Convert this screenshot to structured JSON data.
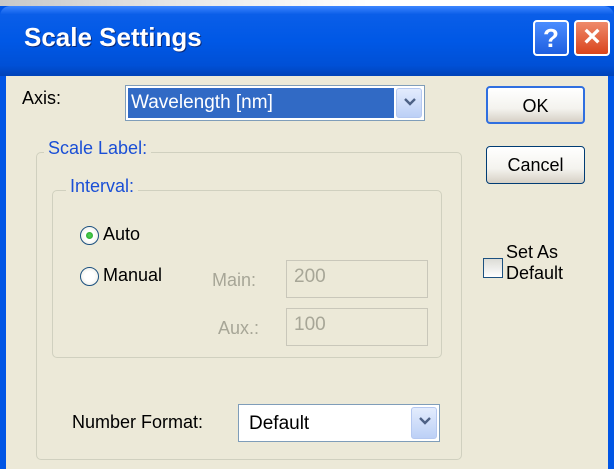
{
  "dialog": {
    "title": "Scale Settings",
    "help_label": "?",
    "close_label": "×"
  },
  "axis": {
    "label": "Axis:",
    "value": "Wavelength [nm]"
  },
  "buttons": {
    "ok_label": "OK",
    "cancel_label": "Cancel"
  },
  "scale_label": {
    "legend": "Scale Label:",
    "interval": {
      "legend": "Interval:",
      "auto_label": "Auto",
      "auto_selected": true,
      "manual_label": "Manual",
      "manual_selected": false,
      "main_label": "Main:",
      "main_value": "200",
      "aux_label": "Aux.:",
      "aux_value": "100"
    },
    "number_format": {
      "label": "Number Format:",
      "value": "Default"
    }
  },
  "set_as_default": {
    "line1": "Set As",
    "line2": "Default",
    "checked": false
  },
  "colors": {
    "title_bar": "#0058e6",
    "dialog_bg": "#ece9d8",
    "group_legend": "#1a4fd6",
    "selection": "#316ac5",
    "disabled_text": "#a7a697"
  }
}
